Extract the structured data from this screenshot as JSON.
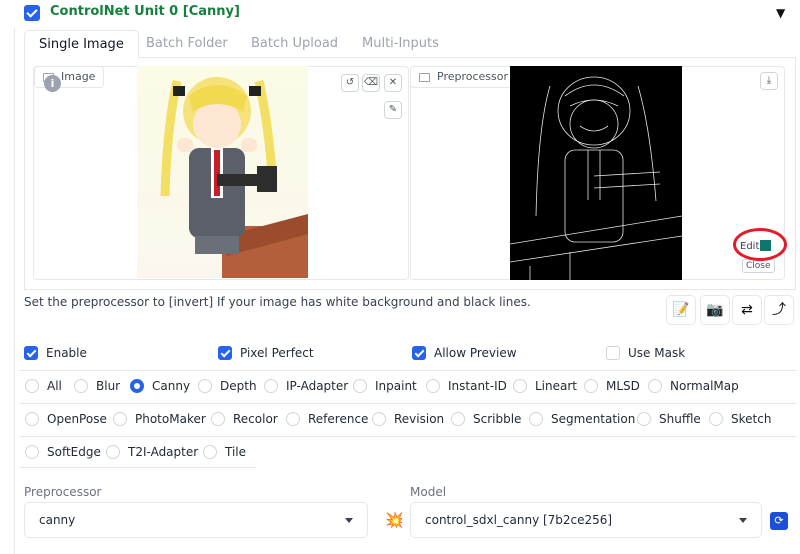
{
  "header": {
    "enabled": true,
    "title": "ControlNet Unit 0 [Canny]",
    "collapse_icon": "triangle-down-icon"
  },
  "tabs": [
    {
      "label": "Single Image",
      "active": true
    },
    {
      "label": "Batch Folder",
      "active": false
    },
    {
      "label": "Batch Upload",
      "active": false
    },
    {
      "label": "Multi-Inputs",
      "active": false
    }
  ],
  "image_input": {
    "label": "Image",
    "info_icon": "i",
    "buttons": [
      "undo-icon",
      "eraser-icon",
      "close-icon",
      "brush-icon"
    ]
  },
  "preview": {
    "label": "Preprocessor Preview",
    "download_icon": "download-icon",
    "edit_label": "Edit",
    "close_label": "Close"
  },
  "hint": "Set the preprocessor to [invert] If your image has white background and black lines.",
  "toolbar": [
    "notepad-icon",
    "camera-icon",
    "swap-icon",
    "arrow-up-right-icon"
  ],
  "options": [
    {
      "label": "Enable",
      "checked": true
    },
    {
      "label": "Pixel Perfect",
      "checked": true
    },
    {
      "label": "Allow Preview",
      "checked": true
    },
    {
      "label": "Use Mask",
      "checked": false
    }
  ],
  "control_types": {
    "items": [
      "All",
      "Blur",
      "Canny",
      "Depth",
      "IP-Adapter",
      "Inpaint",
      "Instant-ID",
      "Lineart",
      "MLSD",
      "NormalMap",
      "OpenPose",
      "PhotoMaker",
      "Recolor",
      "Reference",
      "Revision",
      "Scribble",
      "Segmentation",
      "Shuffle",
      "Sketch",
      "SoftEdge",
      "T2I-Adapter",
      "Tile"
    ],
    "selected": "Canny"
  },
  "preprocessor": {
    "label": "Preprocessor",
    "value": "canny"
  },
  "run_icon": "💥",
  "model": {
    "label": "Model",
    "value": "control_sdxl_canny [7b2ce256]"
  },
  "refresh_icon": "refresh-icon",
  "colors": {
    "accent": "#2563eb",
    "title_green": "#15803d",
    "highlight_red": "#e11d2a"
  }
}
